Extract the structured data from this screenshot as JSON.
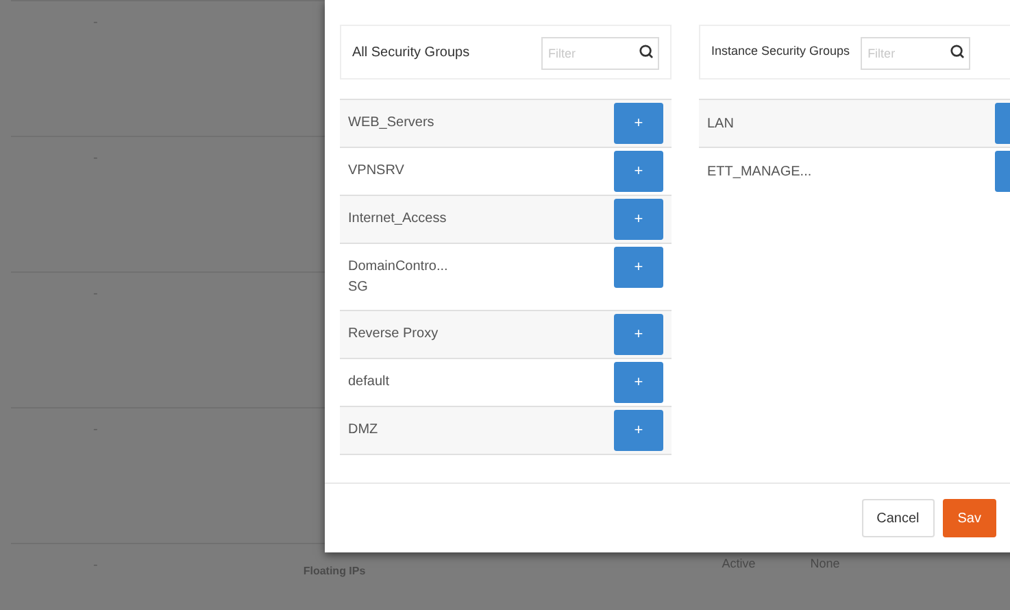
{
  "background_table": {
    "rows": [
      {
        "column_2": "-"
      },
      {
        "column_2": "-"
      },
      {
        "column_2": "-"
      },
      {
        "column_2": "-"
      },
      {
        "column_2": "-",
        "floating_label": "Floating IPs",
        "status": "Active",
        "column_6": "None"
      }
    ]
  },
  "modal": {
    "all_groups": {
      "title": "All Security Groups",
      "search": {
        "placeholder": "Filter"
      },
      "items": [
        {
          "name": "WEB_Servers"
        },
        {
          "name": "VPNSRV"
        },
        {
          "name": "Internet_Access"
        },
        {
          "name": "DomainContro...\nSG"
        },
        {
          "name": "Reverse Proxy"
        },
        {
          "name": "default"
        },
        {
          "name": "DMZ"
        }
      ],
      "action": "+"
    },
    "instance_groups": {
      "title": "Instance Security Groups",
      "search": {
        "placeholder": "Filter"
      },
      "items": [
        {
          "name": "LAN"
        },
        {
          "name": "ETT_MANAGE..."
        }
      ]
    },
    "buttons": [
      {
        "label": "Cancel",
        "kind": "secondary"
      },
      {
        "label": "Sav",
        "kind": "primary"
      }
    ]
  }
}
